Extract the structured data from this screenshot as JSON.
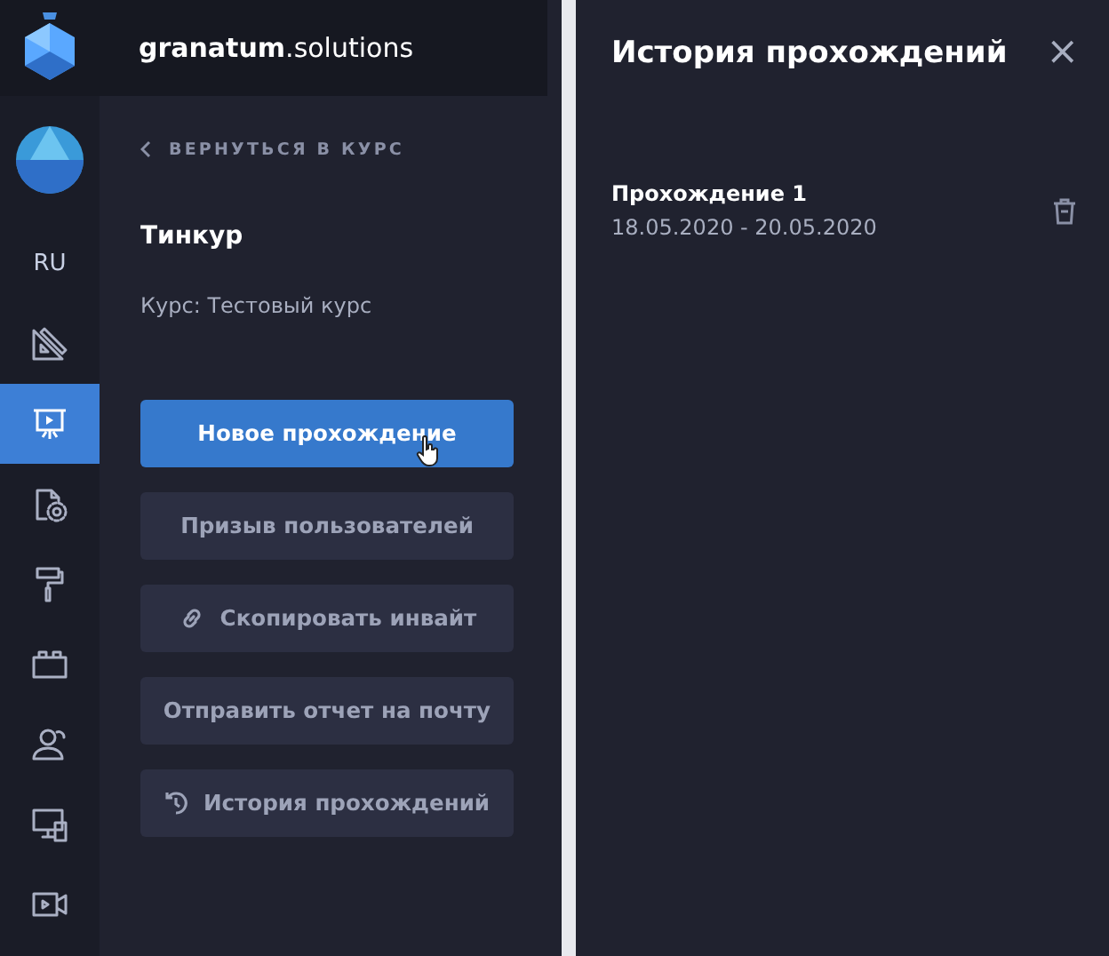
{
  "brand": {
    "name": "granatum",
    "suffix": ".solutions"
  },
  "rail": [
    {
      "kind": "avatar",
      "selected": false
    },
    {
      "kind": "lang",
      "label": "RU",
      "selected": false
    },
    {
      "kind": "icon",
      "selected": false
    },
    {
      "kind": "icon",
      "selected": true
    },
    {
      "kind": "icon",
      "selected": false
    },
    {
      "kind": "icon",
      "selected": false
    },
    {
      "kind": "icon",
      "selected": false
    },
    {
      "kind": "icon",
      "selected": false
    },
    {
      "kind": "icon",
      "selected": false
    },
    {
      "kind": "icon",
      "selected": false
    }
  ],
  "back_link": "ВЕРНУТЬСЯ В КУРС",
  "title": "Тинкур",
  "course": "Курс: Тестовый курс",
  "actions": [
    {
      "label": "Новое прохождение",
      "kind": "primary"
    },
    {
      "label": "Призыв пользователей",
      "kind": "secondary"
    },
    {
      "label": "Скопировать инвайт",
      "kind": "secondary"
    },
    {
      "label": "Отправить отчет на почту",
      "kind": "secondary"
    },
    {
      "label": "История прохождений",
      "kind": "secondary"
    }
  ],
  "panel": {
    "title": "История прохождений",
    "close": "×",
    "entries": [
      {
        "name": "Прохождение 1",
        "dates": "18.05.2020 - 20.05.2020"
      }
    ]
  }
}
